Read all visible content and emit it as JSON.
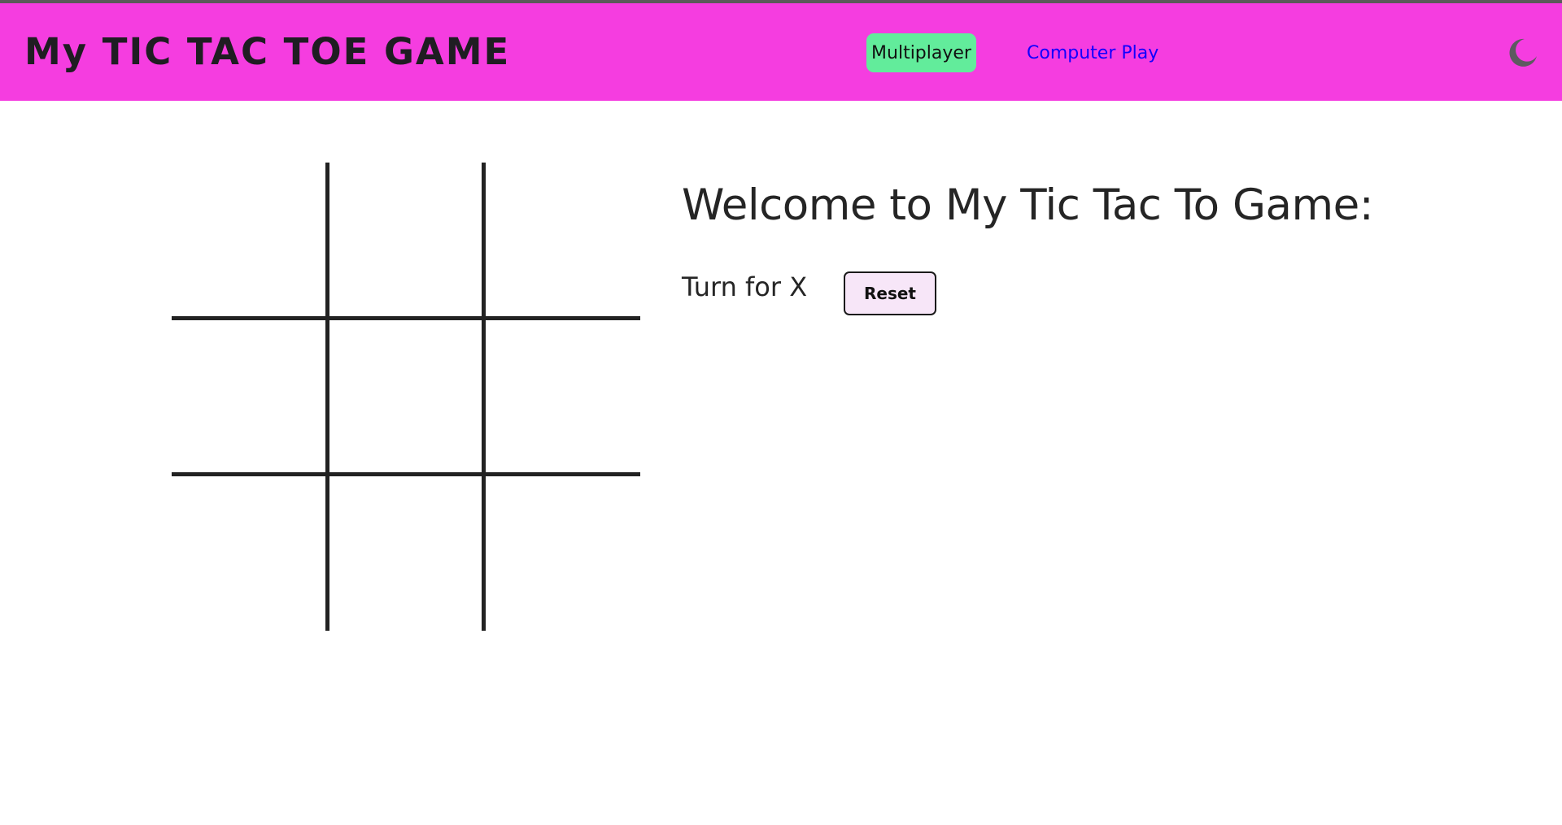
{
  "header": {
    "brand": "My TIC TAC TOE GAME",
    "nav": {
      "multiplayer_label": "Multiplayer",
      "computer_play_label": "Computer Play"
    },
    "theme_toggle_icon": "moon-icon"
  },
  "game": {
    "board_cells": [
      "",
      "",
      "",
      "",
      "",
      "",
      "",
      "",
      ""
    ],
    "welcome_heading": "Welcome to My Tic Tac To Game:",
    "turn_text": "Turn for X",
    "reset_label": "Reset"
  },
  "colors": {
    "navbar_bg": "#f53de0",
    "multiplayer_active_bg": "#62ec9b",
    "link_color": "#1200ff",
    "reset_bg": "#f7e6f8",
    "grid_line": "#222222",
    "moon_icon": "#5e5a60"
  }
}
